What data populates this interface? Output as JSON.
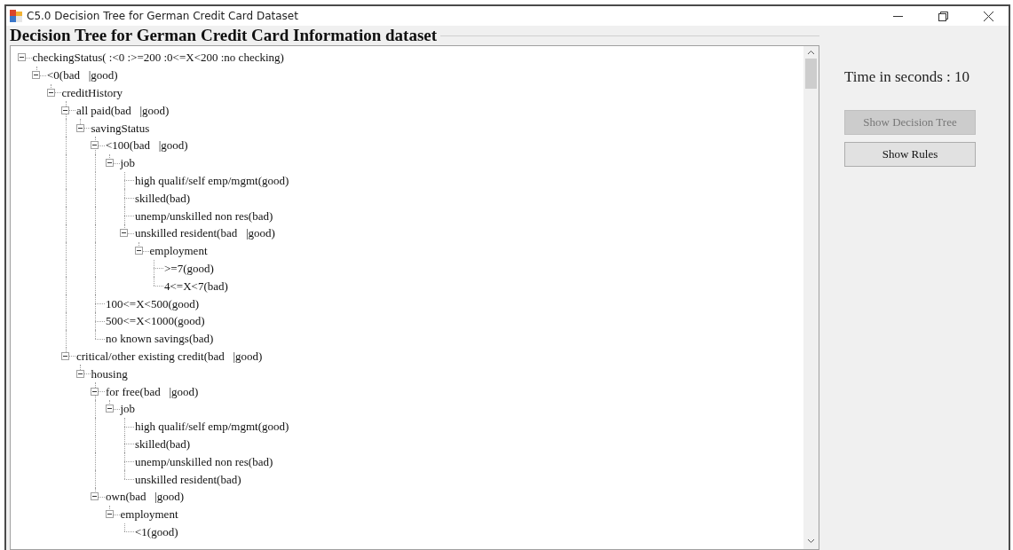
{
  "window": {
    "title": "C5.0 Decision Tree for German Credit Card Dataset"
  },
  "group": {
    "title": "Decision Tree for German Credit Card Information dataset"
  },
  "tree": [
    {
      "label": "checkingStatus( :<0 :>=200 :0<=X<200 :no checking)",
      "expanded": true,
      "children": [
        {
          "label": "<0(bad   |good)",
          "expanded": true,
          "children": [
            {
              "label": "creditHistory",
              "expanded": true,
              "children": [
                {
                  "label": "all paid(bad   |good)",
                  "expanded": true,
                  "children": [
                    {
                      "label": "savingStatus",
                      "expanded": true,
                      "children": [
                        {
                          "label": "<100(bad   |good)",
                          "expanded": true,
                          "children": [
                            {
                              "label": "job",
                              "expanded": true,
                              "children": [
                                {
                                  "label": "high qualif/self emp/mgmt(good)"
                                },
                                {
                                  "label": "skilled(bad)"
                                },
                                {
                                  "label": "unemp/unskilled non res(bad)"
                                },
                                {
                                  "label": "unskilled resident(bad   |good)",
                                  "expanded": true,
                                  "children": [
                                    {
                                      "label": "employment",
                                      "expanded": true,
                                      "children": [
                                        {
                                          "label": ">=7(good)"
                                        },
                                        {
                                          "label": "4<=X<7(bad)"
                                        }
                                      ]
                                    }
                                  ]
                                }
                              ]
                            }
                          ]
                        },
                        {
                          "label": "100<=X<500(good)"
                        },
                        {
                          "label": "500<=X<1000(good)"
                        },
                        {
                          "label": "no known savings(bad)"
                        }
                      ]
                    }
                  ]
                },
                {
                  "label": "critical/other existing credit(bad   |good)",
                  "expanded": true,
                  "children": [
                    {
                      "label": "housing",
                      "expanded": true,
                      "children": [
                        {
                          "label": "for free(bad   |good)",
                          "expanded": true,
                          "children": [
                            {
                              "label": "job",
                              "expanded": true,
                              "children": [
                                {
                                  "label": "high qualif/self emp/mgmt(good)"
                                },
                                {
                                  "label": "skilled(bad)"
                                },
                                {
                                  "label": "unemp/unskilled non res(bad)"
                                },
                                {
                                  "label": "unskilled resident(bad)"
                                }
                              ]
                            }
                          ]
                        },
                        {
                          "label": "own(bad   |good)",
                          "expanded": true,
                          "children": [
                            {
                              "label": "employment",
                              "expanded": true,
                              "children": [
                                {
                                  "label": "<1(good)"
                                }
                              ]
                            }
                          ]
                        }
                      ]
                    }
                  ]
                }
              ]
            }
          ]
        }
      ]
    }
  ],
  "timer": {
    "label": "Time in seconds : 10"
  },
  "buttons": [
    {
      "label": "Show Decision Tree",
      "disabled": true
    },
    {
      "label": "Show Rules",
      "disabled": false
    }
  ]
}
